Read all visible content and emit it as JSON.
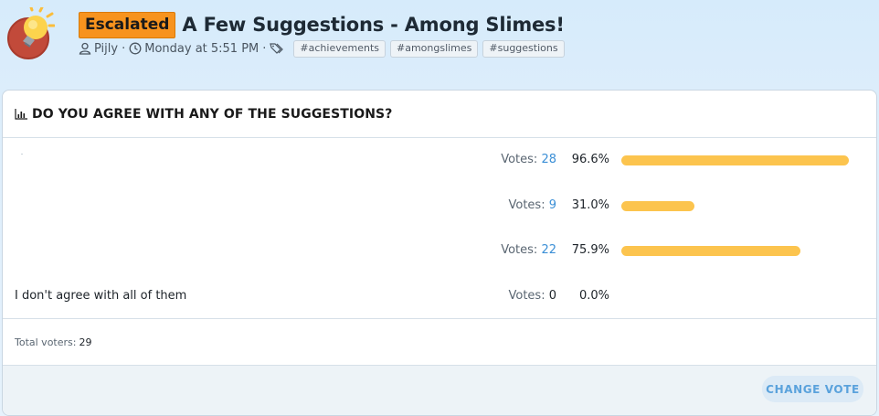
{
  "thread": {
    "prefix_badge": "Escalated",
    "title": "A Few Suggestions - Among Slimes!",
    "author": "Pijly",
    "date": "Monday at 5:51 PM",
    "tags": [
      "#achievements",
      "#amongslimes",
      "#suggestions"
    ],
    "badge_color": "#f7931e"
  },
  "poll": {
    "question": "DO YOU AGREE WITH ANY OF THE SUGGESTIONS?",
    "votes_label": "Votes:",
    "options": [
      {
        "label": "",
        "votes": "28",
        "percent": "96.6%",
        "fraction": 0.966
      },
      {
        "label": "",
        "votes": "9",
        "percent": "31.0%",
        "fraction": 0.31
      },
      {
        "label": "",
        "votes": "22",
        "percent": "75.9%",
        "fraction": 0.759
      },
      {
        "label": "I don't agree with all of them",
        "votes": "0",
        "percent": "0.0%",
        "fraction": 0.0
      }
    ],
    "total_label": "Total voters:",
    "total_voters": "29",
    "change_vote_label": "CHANGE VOTE",
    "bar_color": "#fcc44e",
    "link_color": "#3b8fd6"
  }
}
